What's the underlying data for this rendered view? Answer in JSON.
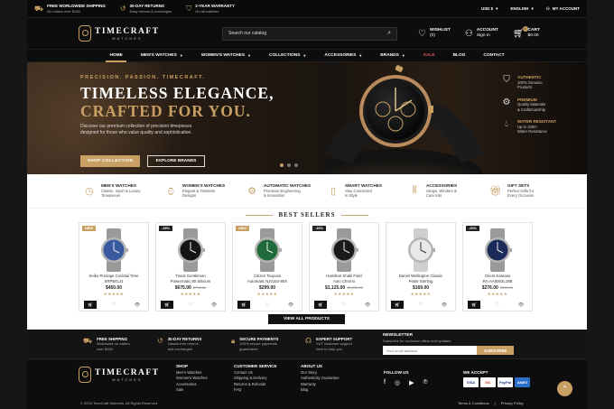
{
  "topbar": {
    "items": [
      {
        "icon": "truck-icon",
        "title": "FREE WORLDWIDE SHIPPING",
        "sub": "On orders over $150"
      },
      {
        "icon": "return-icon",
        "title": "30-DAY RETURNS",
        "sub": "Easy returns & exchanges"
      },
      {
        "icon": "shield-icon",
        "title": "2-YEAR WARRANTY",
        "sub": "On all watches"
      }
    ],
    "currency": "USD $",
    "language": "ENGLISH",
    "account": "MY ACCOUNT"
  },
  "brand": {
    "name": "TIMECRAFT",
    "sub": "WATCHES"
  },
  "search": {
    "placeholder": "Search our catalog"
  },
  "header": {
    "wishlist_label": "WISHLIST",
    "wishlist_count": "(0)",
    "account_label": "ACCOUNT",
    "account_sub": "Sign In",
    "cart_label": "CART",
    "cart_total": "$0.00",
    "cart_count": "0"
  },
  "nav": {
    "home": "HOME",
    "mens": "MEN'S WATCHES",
    "womens": "WOMEN'S WATCHES",
    "collections": "COLLECTIONS",
    "accessories": "ACCESSORIES",
    "brands": "BRANDS",
    "sale": "SALE",
    "blog": "BLOG",
    "contact": "CONTACT"
  },
  "hero": {
    "tag": "PRECISION. PASSION. TIMECRAFT.",
    "line1": "TIMELESS ELEGANCE,",
    "line2": "CRAFTED FOR YOU.",
    "para": "Discover our premium collection of precision timepieces designed for those who value quality and sophistication.",
    "btn_primary": "SHOP COLLECTION",
    "btn_secondary": "EXPLORE BRANDS",
    "features": [
      {
        "title": "AUTHENTIC",
        "line1": "100% Genuine",
        "line2": "Products"
      },
      {
        "title": "PREMIUM",
        "line1": "Quality Materials",
        "line2": "& Craftsmanship"
      },
      {
        "title": "WATER RESISTANT",
        "line1": "Up to 100m",
        "line2": "Water Resistance"
      }
    ]
  },
  "categories": [
    {
      "title": "MEN'S WATCHES",
      "line1": "Classic, Sport & Luxury",
      "line2": "Timepieces"
    },
    {
      "title": "WOMEN'S WATCHES",
      "line1": "Elegant & Timeless",
      "line2": "Designs"
    },
    {
      "title": "AUTOMATIC WATCHES",
      "line1": "Precision Engineering",
      "line2": "& Innovation"
    },
    {
      "title": "SMART WATCHES",
      "line1": "Stay Connected",
      "line2": "In Style"
    },
    {
      "title": "ACCESSORIES",
      "line1": "Straps, Winders &",
      "line2": "Care Kits"
    },
    {
      "title": "GIFT SETS",
      "line1": "Perfect Gifts for",
      "line2": "Every Occasion"
    }
  ],
  "bestsellers": {
    "title": "BEST SELLERS",
    "products": [
      {
        "badge": "NEW",
        "name1": "Seiko Presage Cocktail Time",
        "name2": "SRPB41J1",
        "price": "$450.00",
        "old": "",
        "stars": "★★★★★",
        "dial": "#3a5aa0"
      },
      {
        "badge": "-15%",
        "name1": "Tissot Gentleman",
        "name2": "Powermatic 80 Silicium",
        "price": "$675.00",
        "old": "$795.00",
        "stars": "★★★★★",
        "dial": "#151515"
      },
      {
        "badge": "NEW",
        "name1": "Citizen Tsuyosa",
        "name2": "Automatic NJ0154-80X",
        "price": "$299.00",
        "old": "",
        "stars": "★★★★★",
        "dial": "#1f6a3a"
      },
      {
        "badge": "-10%",
        "name1": "Hamilton Khaki Field",
        "name2": "Auto Chrono",
        "price": "$1,125.00",
        "old": "$1,250.00",
        "stars": "★★★★★",
        "dial": "#1a1a1a"
      },
      {
        "badge": "",
        "name1": "Daniel Wellington Classic",
        "name2": "Petite Sterling",
        "price": "$169.00",
        "old": "",
        "stars": "★★★★★",
        "dial": "#e8e8e8"
      },
      {
        "badge": "-20%",
        "name1": "Orient Kamasu",
        "name2": "RA-AA0003L19B",
        "price": "$276.00",
        "old": "$345.00",
        "stars": "★★★★★",
        "dial": "#1c2a5a"
      }
    ],
    "view_all": "VIEW ALL PRODUCTS"
  },
  "features_bar": [
    {
      "title": "FREE SHIPPING",
      "line1": "Worldwide on orders",
      "line2": "over $150"
    },
    {
      "title": "30-DAY RETURNS",
      "line1": "Hassle-free returns",
      "line2": "and exchanges"
    },
    {
      "title": "SECURE PAYMENTS",
      "line1": "100% secure payments",
      "line2": "guaranteed"
    },
    {
      "title": "EXPERT SUPPORT",
      "line1": "24/7 customer support",
      "line2": "here to help you"
    }
  ],
  "newsletter": {
    "title": "NEWSLETTER",
    "sub": "Subscribe for exclusive offers and updates",
    "placeholder": "Your email address",
    "button": "SUBSCRIBE"
  },
  "footer": {
    "shop": {
      "title": "SHOP",
      "links": [
        "Men's Watches",
        "Women's Watches",
        "Accessories",
        "Sale"
      ]
    },
    "service": {
      "title": "CUSTOMER SERVICE",
      "links": [
        "Contact Us",
        "Shipping & Delivery",
        "Returns & Refunds",
        "FAQ"
      ]
    },
    "about": {
      "title": "ABOUT US",
      "links": [
        "Our Story",
        "Authenticity Guarantee",
        "Warranty",
        "Blog"
      ]
    },
    "follow": "FOLLOW US",
    "accept": "WE ACCEPT",
    "payments": [
      "VISA",
      "MC",
      "PayPal",
      "AMEX"
    ],
    "copyright": "© 2024 TimeCraft Watches. All Rights Reserved.",
    "terms": "Terms & Conditions",
    "sep": "|",
    "privacy": "Privacy Policy"
  },
  "colors": {
    "accent": "#c9a064",
    "sale": "#e05050",
    "dark": "#0d0d0d"
  }
}
